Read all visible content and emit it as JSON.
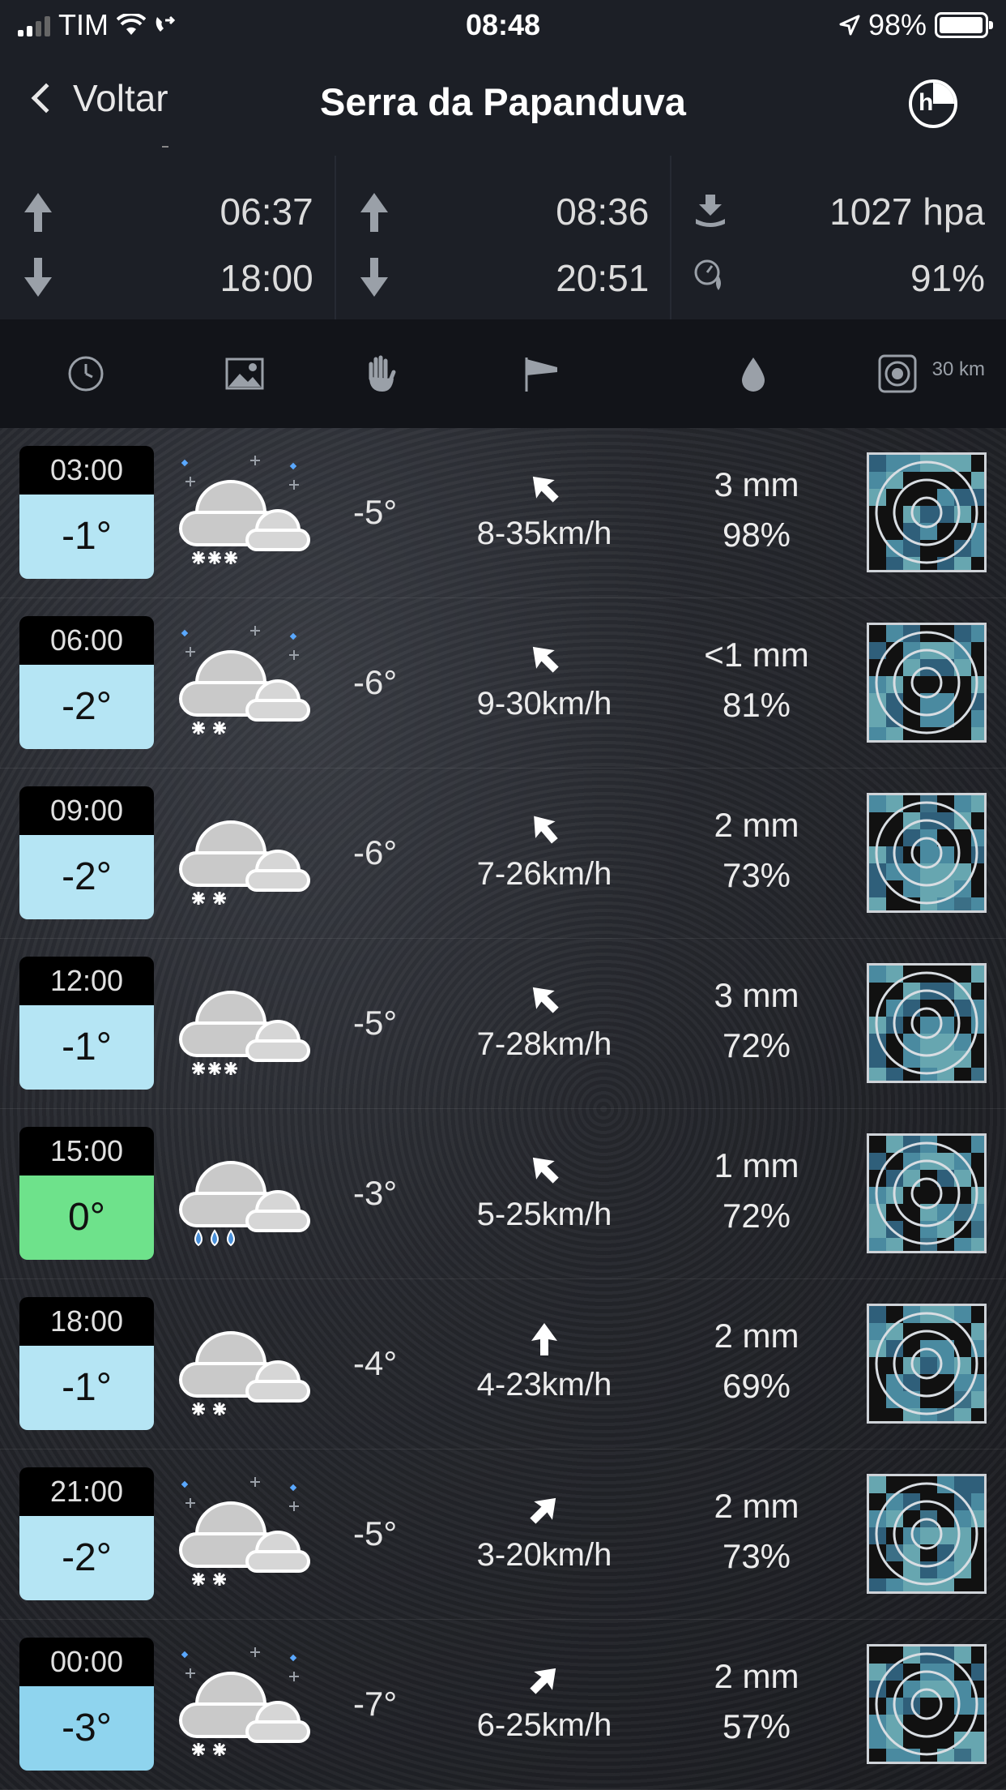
{
  "status_bar": {
    "carrier": "TIM",
    "time": "08:48",
    "battery": "98%",
    "battery_level": 0.98
  },
  "nav": {
    "back_label": "Voltar",
    "title": "Serra da Papanduva",
    "history_icon": "hours-clock-icon"
  },
  "info": {
    "sunrise": "06:37",
    "sunset": "18:00",
    "moonrise": "08:36",
    "moonset": "20:51",
    "pressure": "1027 hpa",
    "humidity": "91%"
  },
  "header": {
    "icons": [
      "clock-icon",
      "sky-image-icon",
      "feels-hand-icon",
      "wind-flag-icon",
      "drop-icon",
      "radar-icon"
    ],
    "radius": "30 km"
  },
  "forecast": [
    {
      "time": "03:00",
      "temp": "-1°",
      "feels": "-5°",
      "wind": "8-35km/h",
      "wind_dir_deg": 315,
      "precip": "3 mm",
      "humidity": "98%",
      "icon": "snow-heavy-stars",
      "temp_color": "light"
    },
    {
      "time": "06:00",
      "temp": "-2°",
      "feels": "-6°",
      "wind": "9-30km/h",
      "wind_dir_deg": 315,
      "precip": "<1 mm",
      "humidity": "81%",
      "icon": "snow-light-stars",
      "temp_color": "light"
    },
    {
      "time": "09:00",
      "temp": "-2°",
      "feels": "-6°",
      "wind": "7-26km/h",
      "wind_dir_deg": 320,
      "precip": "2 mm",
      "humidity": "73%",
      "icon": "snow-light",
      "temp_color": "light"
    },
    {
      "time": "12:00",
      "temp": "-1°",
      "feels": "-5°",
      "wind": "7-28km/h",
      "wind_dir_deg": 315,
      "precip": "3 mm",
      "humidity": "72%",
      "icon": "snow-heavy",
      "temp_color": "light"
    },
    {
      "time": "15:00",
      "temp": "0°",
      "feels": "-3°",
      "wind": "5-25km/h",
      "wind_dir_deg": 315,
      "precip": "1 mm",
      "humidity": "72%",
      "icon": "rain",
      "temp_color": "green"
    },
    {
      "time": "18:00",
      "temp": "-1°",
      "feels": "-4°",
      "wind": "4-23km/h",
      "wind_dir_deg": 0,
      "precip": "2 mm",
      "humidity": "69%",
      "icon": "snow-light",
      "temp_color": "light"
    },
    {
      "time": "21:00",
      "temp": "-2°",
      "feels": "-5°",
      "wind": "3-20km/h",
      "wind_dir_deg": 45,
      "precip": "2 mm",
      "humidity": "73%",
      "icon": "snow-light-stars",
      "temp_color": "light"
    },
    {
      "time": "00:00",
      "temp": "-3°",
      "feels": "-7°",
      "wind": "6-25km/h",
      "wind_dir_deg": 45,
      "precip": "2 mm",
      "humidity": "57%",
      "icon": "snow-light-stars",
      "temp_color": "darkblue"
    }
  ],
  "colors": {
    "temp_light": "#b5e5f4",
    "temp_green": "#6ee28b",
    "temp_darkblue": "#8fd4ee",
    "radar_base": "#3b6f86"
  }
}
